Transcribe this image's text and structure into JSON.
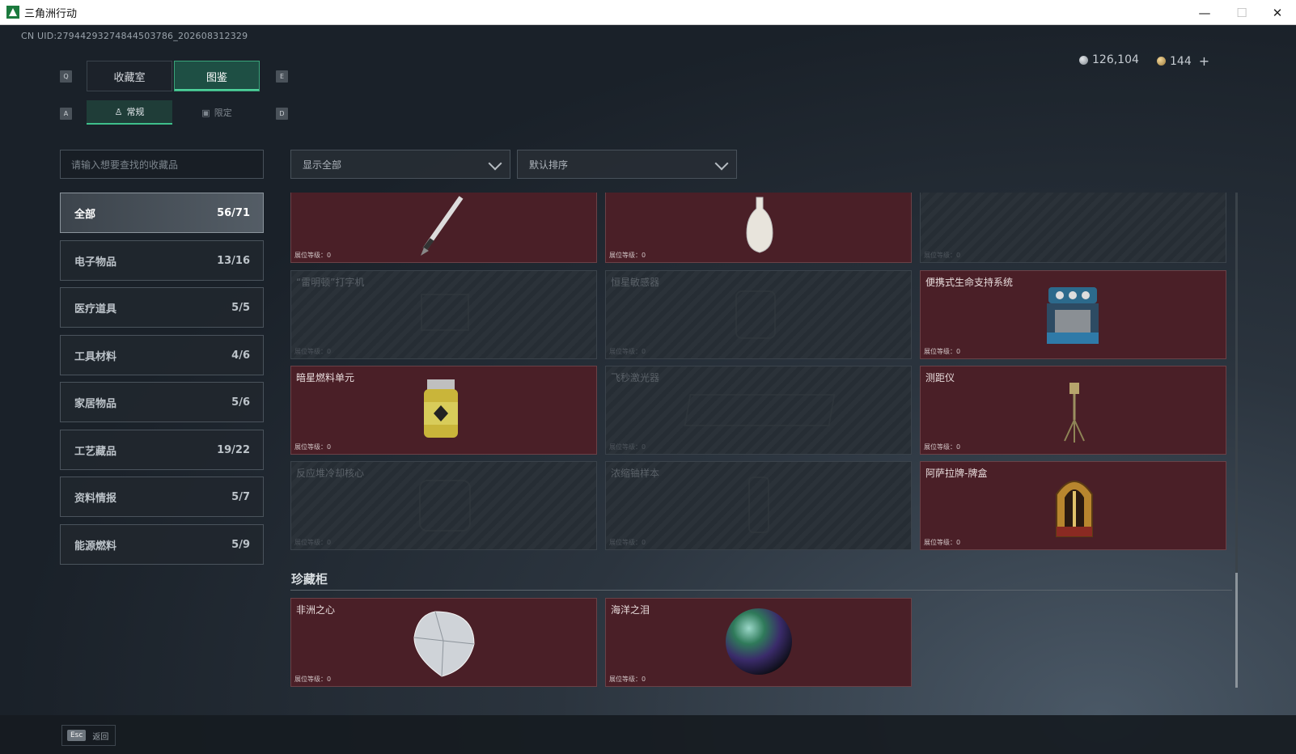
{
  "window": {
    "title": "三角洲行动",
    "minimize": "—",
    "maximize": "☐",
    "close": "✕"
  },
  "uid": "CN UID:2794429327484450378​6_202608312329",
  "currency": {
    "coins": "126,104",
    "tokens": "144",
    "add": "+"
  },
  "tabs": [
    {
      "label": "收藏室",
      "key_left": "Q"
    },
    {
      "label": "图鉴",
      "key_right": "E"
    }
  ],
  "subtabs": [
    {
      "label": "常规",
      "key_left": "A"
    },
    {
      "label": "限定",
      "key_right": "D"
    }
  ],
  "search": {
    "placeholder": "请输入想要查找的收藏品"
  },
  "filters": {
    "display": "显示全部",
    "sort": "默认排序"
  },
  "categories": [
    {
      "label": "全部",
      "count": "56/71"
    },
    {
      "label": "电子物品",
      "count": "13/16"
    },
    {
      "label": "医疗道具",
      "count": "5/5"
    },
    {
      "label": "工具材料",
      "count": "4/6"
    },
    {
      "label": "家居物品",
      "count": "5/6"
    },
    {
      "label": "工艺藏品",
      "count": "19/22"
    },
    {
      "label": "资料情报",
      "count": "5/7"
    },
    {
      "label": "能源燃料",
      "count": "5/9"
    }
  ],
  "level_label": "展位等级：0",
  "items": [
    {
      "name": "",
      "icon": "pen-icon"
    },
    {
      "name": "",
      "icon": "vase-icon"
    },
    {
      "name": "",
      "icon": "locked-item-icon"
    },
    {
      "name": "“雷明顿”打字机",
      "icon": "typewriter-icon"
    },
    {
      "name": "恒星敏感器",
      "icon": "star-sensor-icon"
    },
    {
      "name": "便携式生命支持系统",
      "icon": "life-support-icon"
    },
    {
      "name": "暗星燃料单元",
      "icon": "fuel-cell-icon"
    },
    {
      "name": "飞秒激光器",
      "icon": "laser-icon"
    },
    {
      "name": "测距仪",
      "icon": "rangefinder-icon"
    },
    {
      "name": "反应堆冷却核心",
      "icon": "reactor-core-icon"
    },
    {
      "name": "浓缩铀样本",
      "icon": "uranium-icon"
    },
    {
      "name": "阿萨拉牌-牌盒",
      "icon": "card-box-icon"
    }
  ],
  "cabinet": {
    "title": "珍藏柜",
    "items": [
      {
        "name": "非洲之心",
        "icon": "diamond-icon"
      },
      {
        "name": "海洋之泪",
        "icon": "pearl-icon"
      }
    ]
  },
  "footer": {
    "esc_key": "Esc",
    "back_label": "返回"
  },
  "colors": {
    "accent": "#3fbf8b",
    "owned_card": "#4a1f27",
    "locked_card": "#262d34"
  }
}
